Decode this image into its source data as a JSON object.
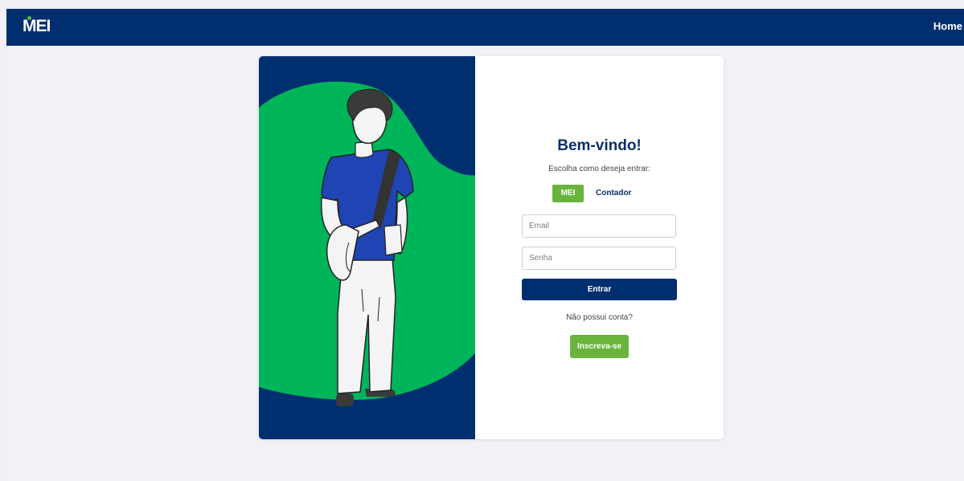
{
  "header": {
    "logo_text": "MEI",
    "nav_home": "Home"
  },
  "login": {
    "title": "Bem-vindo!",
    "subtitle": "Escolha como deseja entrar:",
    "type_options": [
      "MEI",
      "Contador"
    ],
    "selected_type": "MEI",
    "email_placeholder": "Email",
    "password_placeholder": "Senha",
    "submit_label": "Entrar",
    "no_account_text": "Não possui conta?",
    "signup_label": "Inscreva-se"
  },
  "colors": {
    "primary_navy": "#002f70",
    "accent_green": "#6ab43d",
    "illustration_green": "#00b45a",
    "page_background": "#f1f1f6"
  }
}
